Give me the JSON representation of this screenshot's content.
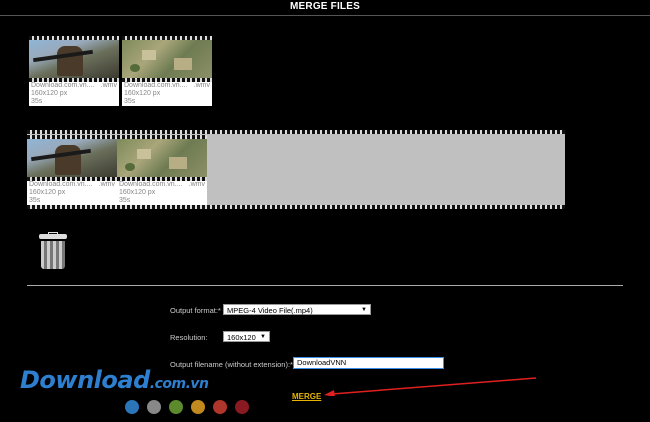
{
  "header": {
    "title": "MERGE FILES"
  },
  "source_files": [
    {
      "name": "Download.com.vn....",
      "ext": ".wmv",
      "dims": "160x120 px",
      "duration": "35s",
      "thumb": "soldier"
    },
    {
      "name": "Download.com.vn....",
      "ext": ".wmv",
      "dims": "160x120 px",
      "duration": "35s",
      "thumb": "map"
    }
  ],
  "timeline_files": [
    {
      "name": "Download.com.vn....",
      "ext": ".wmv",
      "dims": "160x120 px",
      "duration": "35s",
      "thumb": "soldier"
    },
    {
      "name": "Download.com.vn....",
      "ext": ".wmv",
      "dims": "160x120 px",
      "duration": "35s",
      "thumb": "map"
    }
  ],
  "trash": {
    "icon": "trash-icon"
  },
  "form": {
    "output_format_label": "Output format:*",
    "output_format_value": "MPEG-4 Video File(.mp4)",
    "resolution_label": "Resolution:",
    "resolution_value": "160x120",
    "filename_label": "Output filename (without extension):*",
    "filename_value": "DownloadVNN",
    "merge_label": "MERGE"
  },
  "watermark": {
    "brand": "Download",
    "tld": ".com.vn"
  },
  "dots": [
    "#2a76b8",
    "#888888",
    "#5c8a2c",
    "#c28a1e",
    "#b0352a",
    "#8a1a22"
  ],
  "colors": {
    "accent": "#e8b400",
    "arrow": "#e02020"
  }
}
